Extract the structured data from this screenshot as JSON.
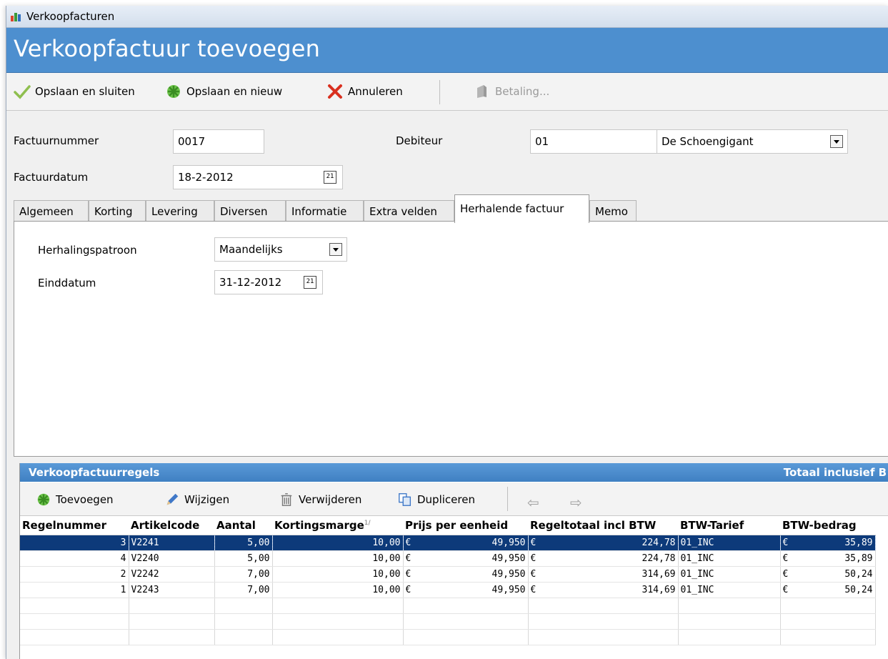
{
  "window": {
    "title": "Verkoopfacturen",
    "header_title": "Verkoopfactuur toevoegen"
  },
  "toolbar": {
    "save_close": "Opslaan en sluiten",
    "save_new": "Opslaan en nieuw",
    "cancel": "Annuleren",
    "payment": "Betaling..."
  },
  "form": {
    "invoice_number_label": "Factuurnummer",
    "invoice_number_value": "0017",
    "invoice_date_label": "Factuurdatum",
    "invoice_date_value": "18-2-2012",
    "debtor_label": "Debiteur",
    "debtor_code": "01",
    "debtor_name": "De Schoengigant"
  },
  "tabs": [
    "Algemeen",
    "Korting",
    "Levering",
    "Diversen",
    "Informatie",
    "Extra velden",
    "Herhalende factuur",
    "Memo"
  ],
  "active_tab": "Herhalende factuur",
  "recurring": {
    "pattern_label": "Herhalingspatroon",
    "pattern_value": "Maandelijks",
    "end_date_label": "Einddatum",
    "end_date_value": "31-12-2012"
  },
  "grid": {
    "title": "Verkoopfactuurregels",
    "total_label": "Totaal inclusief B",
    "toolbar": {
      "add": "Toevoegen",
      "edit": "Wijzigen",
      "delete": "Verwijderen",
      "duplicate": "Dupliceren"
    },
    "columns": [
      "Regelnummer",
      "Artikelcode",
      "Aantal",
      "Kortingsmarge",
      "Prijs per eenheid",
      "Regeltotaal incl BTW",
      "BTW-Tarief",
      "BTW-bedrag"
    ],
    "sort_marker": "1/",
    "currency": "€",
    "rows": [
      {
        "nr": "3",
        "code": "V2241",
        "qty": "5,00",
        "disc": "10,00",
        "price": "49,950",
        "total": "224,78",
        "vat": "01_INC",
        "vat_amount": "35,89",
        "selected": true
      },
      {
        "nr": "4",
        "code": "V2240",
        "qty": "5,00",
        "disc": "10,00",
        "price": "49,950",
        "total": "224,78",
        "vat": "01_INC",
        "vat_amount": "35,89",
        "selected": false
      },
      {
        "nr": "2",
        "code": "V2242",
        "qty": "7,00",
        "disc": "10,00",
        "price": "49,950",
        "total": "314,69",
        "vat": "01_INC",
        "vat_amount": "50,24",
        "selected": false
      },
      {
        "nr": "1",
        "code": "V2243",
        "qty": "7,00",
        "disc": "10,00",
        "price": "49,950",
        "total": "314,69",
        "vat": "01_INC",
        "vat_amount": "50,24",
        "selected": false
      }
    ]
  }
}
